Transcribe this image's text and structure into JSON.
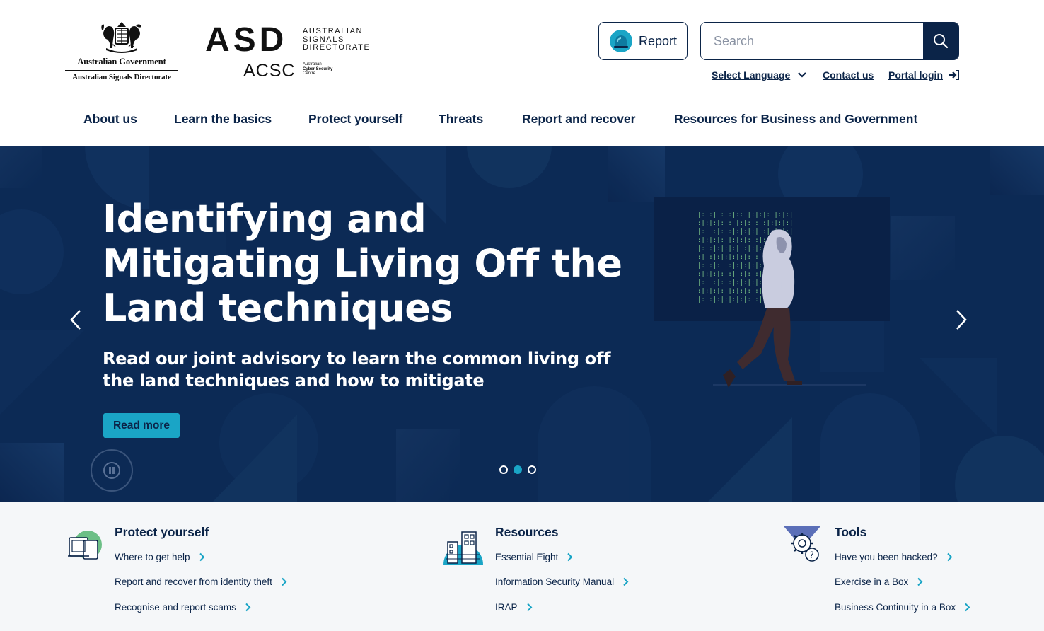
{
  "header": {
    "gov_logo": {
      "line1": "Australian Government",
      "line2": "Australian Signals Directorate"
    },
    "asd_logo": {
      "acronym": "ASD",
      "line1": "AUSTRALIAN",
      "line2": "SIGNALS",
      "line3": "DIRECTORATE",
      "acsc": "ACSC",
      "acsc_line1": "Australian",
      "acsc_line2": "Cyber Security",
      "acsc_line3": "Centre"
    },
    "report_label": "Report",
    "search": {
      "placeholder": "Search",
      "value": ""
    },
    "util_links": {
      "language": "Select Language",
      "contact": "Contact us",
      "portal": "Portal login"
    },
    "nav": [
      {
        "label": "About us"
      },
      {
        "label": "Learn the basics"
      },
      {
        "label": "Protect yourself"
      },
      {
        "label": "Threats"
      },
      {
        "label": "Report and recover"
      },
      {
        "label": "Resources for Business and Government"
      }
    ]
  },
  "hero": {
    "title": "Identifying and Mitigating Living Off the Land techniques",
    "subtitle": "Read our joint advisory to learn the common living off the land techniques and how to mitigate",
    "cta": "Read more",
    "slide_count": 3,
    "active_slide": 2
  },
  "quick_links": [
    {
      "heading": "Protect yourself",
      "icon": "devices-icon",
      "links": [
        "Where to get help",
        "Report and recover from identity theft",
        "Recognise and report scams"
      ]
    },
    {
      "heading": "Resources",
      "icon": "buildings-icon",
      "links": [
        "Essential Eight",
        "Information Security Manual",
        "IRAP"
      ]
    },
    {
      "heading": "Tools",
      "icon": "gear-question-icon",
      "links": [
        "Have you been hacked?",
        "Exercise in a Box",
        "Business Continuity in a Box"
      ]
    }
  ],
  "colors": {
    "navy": "#0b2448",
    "hero_bg": "#0c2a55",
    "accent_teal": "#1aa5c6",
    "quick_bg": "#f5f7f9"
  }
}
